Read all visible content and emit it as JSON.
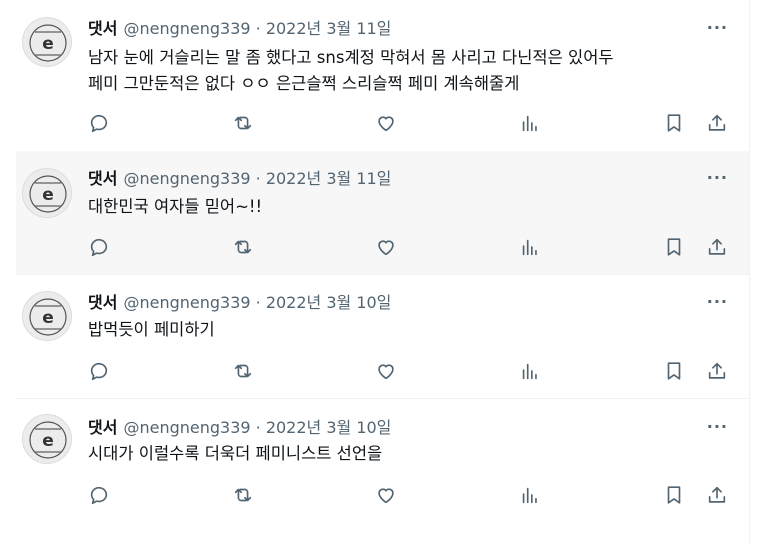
{
  "tweets": [
    {
      "name": "댓서",
      "meta": "@nengneng339 · 2022년 3월 11일",
      "lines": [
        "남자 눈에 거슬리는 말 좀 했다고 sns계정 막혀서 몸 사리고 다닌적은 있어두",
        "페미 그만둔적은 없다 ㅇㅇ 은근슬쩍 스리슬쩍 페미 계속해줄게"
      ],
      "highlighted": false
    },
    {
      "name": "댓서",
      "meta": "@nengneng339 · 2022년 3월 11일",
      "lines": [
        "대한민국 여자들 믿어~!!"
      ],
      "highlighted": true
    },
    {
      "name": "댓서",
      "meta": "@nengneng339 · 2022년 3월 10일",
      "lines": [
        "밥먹듯이 페미하기"
      ],
      "highlighted": false
    },
    {
      "name": "댓서",
      "meta": "@nengneng339 · 2022년 3월 10일",
      "lines": [
        "시대가 이럴수록 더욱더 페미니스트 선언을"
      ],
      "highlighted": false
    }
  ],
  "more_glyph": "···",
  "icons": [
    "reply-icon",
    "retweet-icon",
    "like-icon",
    "views-icon",
    "bookmark-icon",
    "share-icon"
  ],
  "colors": {
    "text": "#0f1419",
    "secondary": "#536471",
    "highlight_bg": "#f7f7f7",
    "divider": "#eff3f4"
  }
}
